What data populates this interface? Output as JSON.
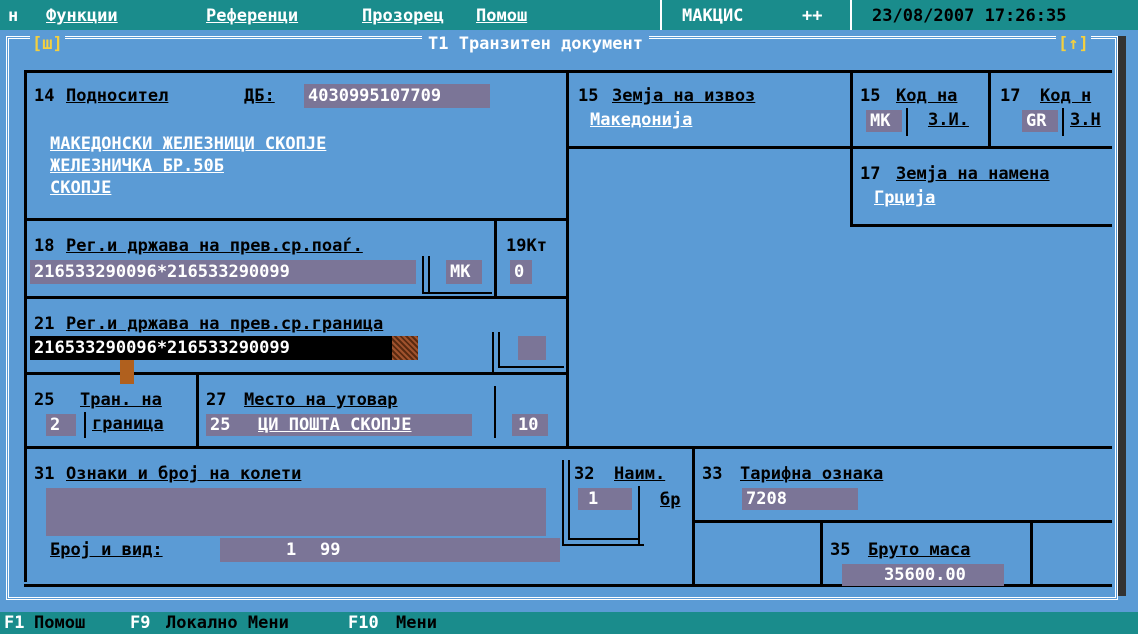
{
  "menu": {
    "items": [
      "н",
      "Функции",
      "Референци",
      "Прозорец",
      "Помош"
    ],
    "app_name": "МАКЦИС",
    "app_suffix": "++",
    "datetime": "23/08/2007 17:26:35"
  },
  "window": {
    "left_tag": "[ш]",
    "title": "T1 Транзитен документ",
    "right_tag": "[↑]"
  },
  "box14": {
    "label_num": "14",
    "label": "Подносител",
    "db_label": "ДБ:",
    "db_value": "4030995107709",
    "line1": "МАКЕДОНСКИ ЖЕЛЕЗНИЦИ СКОПЈЕ",
    "line2": "ЖЕЛЕЗНИЧКА БР.50Б",
    "line3": "СКОПЈЕ"
  },
  "box15": {
    "label_num": "15",
    "label": "Земја на извоз",
    "value": "Македонија"
  },
  "box15code": {
    "label_num": "15",
    "label": "Код на",
    "code": "MK",
    "sub": "З.И."
  },
  "box17code": {
    "label_num": "17",
    "label": "Код н",
    "code": "GR",
    "sub": "З.Н"
  },
  "box17": {
    "label_num": "17",
    "label": "Земја на намена",
    "value": "Грција"
  },
  "box18": {
    "label_num": "18",
    "label": "Рег.и држава на прев.ср.поаѓ.",
    "value": "216533290096*216533290099",
    "country": "MK"
  },
  "box19": {
    "label": "19Кт",
    "value": "0"
  },
  "box21": {
    "label_num": "21",
    "label": "Рег.и држава на прев.ср.граница",
    "value": "216533290096*216533290099"
  },
  "box25": {
    "label_num": "25",
    "label": "Тран. на",
    "value": "2",
    "sub": "граница"
  },
  "box27": {
    "label_num": "27",
    "label": "Место на утовар",
    "code": "25",
    "place": "ЦИ ПОШТА СКОПЈЕ",
    "num": "10"
  },
  "box31": {
    "label_num": "31",
    "label": "Ознаки и број на колети",
    "count_label": "Број и вид:",
    "count_value": "1",
    "count_kind": "99"
  },
  "box32": {
    "label_num": "32",
    "label": "Наим.",
    "value": "1",
    "unit": "бр"
  },
  "box33": {
    "label_num": "33",
    "label": "Тарифна ознака",
    "value": "7208"
  },
  "box35": {
    "label_num": "35",
    "label": "Бруто маса",
    "value": "35600.00"
  },
  "status": {
    "items": [
      {
        "key": "F1",
        "label": "Помош"
      },
      {
        "key": "F9",
        "label": "Локално Мени"
      },
      {
        "key": "F10",
        "label": "Мени"
      }
    ]
  }
}
